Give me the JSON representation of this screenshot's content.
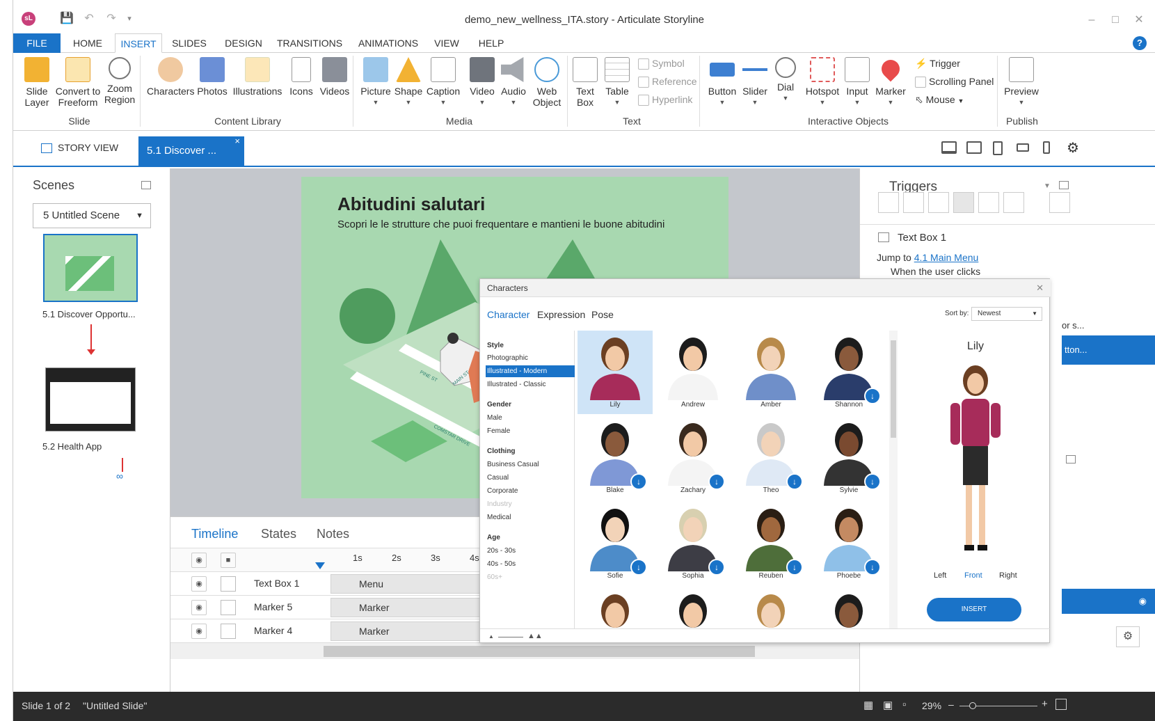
{
  "window": {
    "title": "demo_new_wellness_ITA.story - Articulate Storyline",
    "logo": "sL"
  },
  "ribbon_tabs": [
    "FILE",
    "HOME",
    "INSERT",
    "SLIDES",
    "DESIGN",
    "TRANSITIONS",
    "ANIMATIONS",
    "VIEW",
    "HELP"
  ],
  "ribbon": {
    "slide": {
      "group": "Slide",
      "buttons": [
        {
          "l1": "Slide",
          "l2": "Layer"
        },
        {
          "l1": "Convert to",
          "l2": "Freeform"
        },
        {
          "l1": "Zoom",
          "l2": "Region"
        }
      ]
    },
    "content_library": {
      "group": "Content Library",
      "buttons": [
        "Characters",
        "Photos",
        "Illustrations",
        "Icons",
        "Videos"
      ]
    },
    "media": {
      "group": "Media",
      "buttons": [
        "Picture",
        "Shape",
        "Caption",
        "Video",
        "Audio"
      ],
      "web": {
        "l1": "Web",
        "l2": "Object"
      }
    },
    "text": {
      "group": "Text",
      "textbox": {
        "l1": "Text",
        "l2": "Box"
      },
      "table": "Table",
      "small": [
        "Symbol",
        "Reference",
        "Hyperlink"
      ]
    },
    "interactive": {
      "group": "Interactive Objects",
      "buttons": [
        "Button",
        "Slider",
        "Dial",
        "Hotspot",
        "Input",
        "Marker"
      ],
      "small": [
        "Trigger",
        "Scrolling Panel",
        "Mouse"
      ]
    },
    "publish": {
      "group": "Publish",
      "button": "Preview"
    }
  },
  "docbar": {
    "story_view": "STORY VIEW",
    "slide_tab": "5.1 Discover ...",
    "close": "×"
  },
  "scenes": {
    "title": "Scenes",
    "selector": "5 Untitled Scene",
    "slides": [
      {
        "label": "5.1 Discover Opportu..."
      },
      {
        "label": "5.2 Health App"
      }
    ]
  },
  "slide": {
    "title": "Abitudini salutari",
    "subtitle": "Scopri le le strutture che puoi frequentare e mantieni le buone abitudini",
    "street_labels": [
      "PINE ST",
      "MAIN ST",
      "COMSTAR DRIVE"
    ]
  },
  "timeline": {
    "tabs": [
      "Timeline",
      "States",
      "Notes"
    ],
    "ruler": [
      "1s",
      "2s",
      "3s",
      "4s"
    ],
    "rows": [
      {
        "name": "Text Box 1",
        "bar": "Menu"
      },
      {
        "name": "Marker 5",
        "bar": "Marker"
      },
      {
        "name": "Marker 4",
        "bar": "Marker"
      }
    ]
  },
  "triggers": {
    "title": "Triggers",
    "item": "Text Box 1",
    "action_prefix": "Jump to",
    "action_link": "4.1 Main Menu",
    "condition": "When the user clicks",
    "clipped1": "or s...",
    "clipped2": "tton..."
  },
  "dialog": {
    "title": "Characters",
    "tabs": [
      "Character",
      "Expression",
      "Pose"
    ],
    "sort_label": "Sort by:",
    "sort_value": "Newest",
    "filters": {
      "style": {
        "h": "Style",
        "items": [
          "Photographic",
          "Illustrated - Modern",
          "Illustrated - Classic"
        ]
      },
      "gender": {
        "h": "Gender",
        "items": [
          "Male",
          "Female"
        ]
      },
      "clothing": {
        "h": "Clothing",
        "items": [
          "Business Casual",
          "Casual",
          "Corporate",
          "Industry",
          "Medical"
        ]
      },
      "age": {
        "h": "Age",
        "items": [
          "20s - 30s",
          "40s - 50s",
          "60s+"
        ]
      }
    },
    "characters": [
      "Lily",
      "Andrew",
      "Amber",
      "Shannon",
      "Blake",
      "Zachary",
      "Theo",
      "Sylvie",
      "Sofie",
      "Sophia",
      "Reuben",
      "Phoebe"
    ],
    "preview_name": "Lily",
    "views": [
      "Left",
      "Front",
      "Right"
    ],
    "insert": "INSERT"
  },
  "status": {
    "slide": "Slide 1 of 2",
    "name": "\"Untitled Slide\"",
    "zoom": "29%"
  },
  "colors": {
    "accent": "#1a73c8",
    "slide_bg": "#a8d8b0",
    "statusbar": "#2b2b2b"
  }
}
